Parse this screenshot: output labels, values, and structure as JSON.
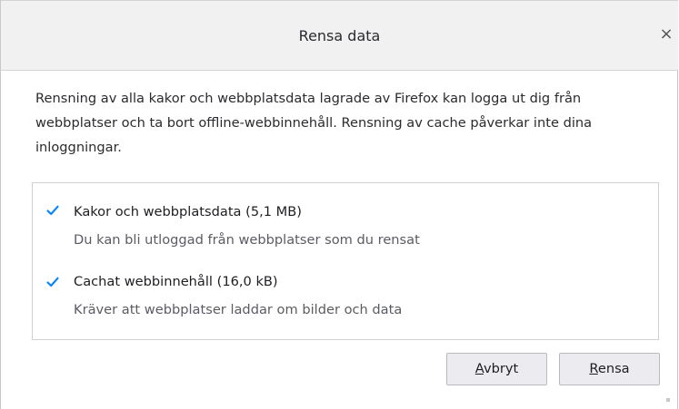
{
  "dialog": {
    "title": "Rensa data",
    "close_symbol": "×",
    "description": "Rensning av alla kakor och webbplatsdata lagrade av Firefox kan logga ut dig från webbplatser och ta bort offline-webbinnehåll. Rensning av cache påverkar inte dina inloggningar."
  },
  "options": [
    {
      "checked": true,
      "label": "Kakor och webbplatsdata (5,1 MB)",
      "description": "Du kan bli utloggad från webbplatser som du rensat"
    },
    {
      "checked": true,
      "label": "Cachat webbinnehåll (16,0 kB)",
      "description": "Kräver att webbplatser laddar om bilder och data"
    }
  ],
  "buttons": {
    "cancel_accesskey": "A",
    "cancel_rest": "vbryt",
    "clear_accesskey": "R",
    "clear_rest": "ensa"
  },
  "colors": {
    "check": "#0a84ff",
    "titlebar_bg": "#f1f1f2",
    "button_bg": "#ececf0"
  }
}
